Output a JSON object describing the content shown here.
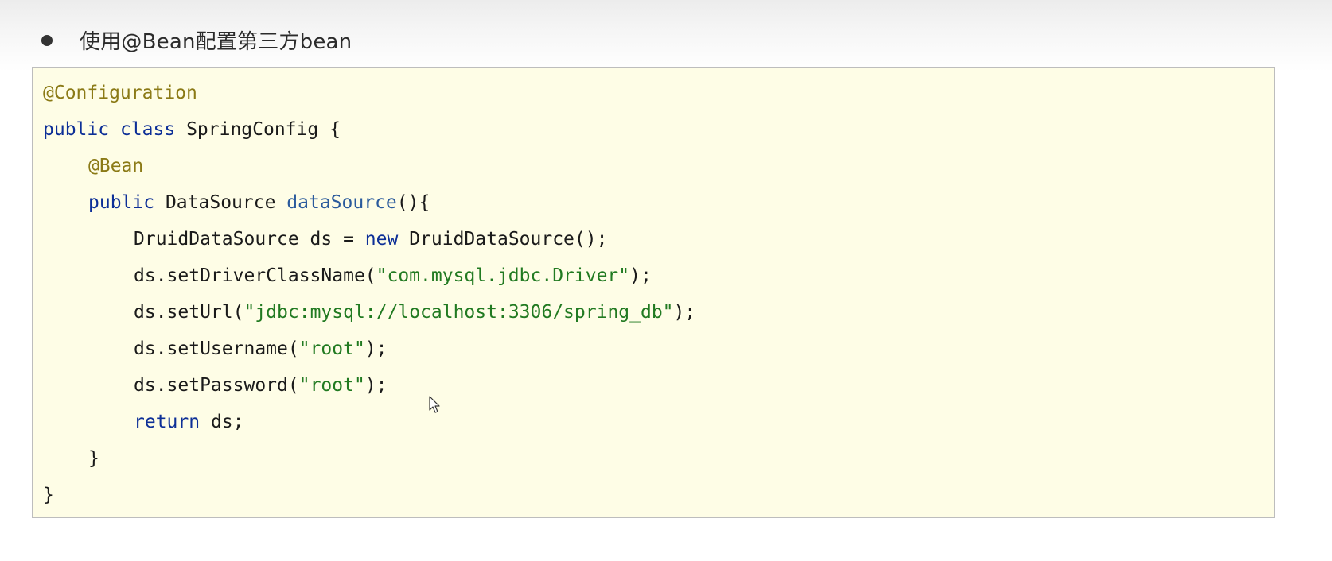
{
  "heading": {
    "bullet": "●",
    "text": "使用@Bean配置第三方bean"
  },
  "code": {
    "line1": {
      "annotation": "@Configuration"
    },
    "line2": {
      "kw1": "public",
      "kw2": "class",
      "rest": "SpringConfig {"
    },
    "line3": {
      "annotation": "@Bean"
    },
    "line4": {
      "kw": "public",
      "type": "DataSource",
      "method": "dataSource",
      "rest": "(){"
    },
    "line5": {
      "pre": "DruidDataSource ds = ",
      "kw": "new",
      "post": " DruidDataSource();"
    },
    "line6": {
      "pre": "ds.setDriverClassName(",
      "str": "\"com.mysql.jdbc.Driver\"",
      "post": ");"
    },
    "line7": {
      "pre": "ds.setUrl(",
      "str": "\"jdbc:mysql://localhost:3306/spring_db\"",
      "post": ");"
    },
    "line8": {
      "pre": "ds.setUsername(",
      "str": "\"root\"",
      "post": ");"
    },
    "line9": {
      "pre": "ds.setPassword(",
      "str": "\"root\"",
      "post": ");"
    },
    "line10": {
      "kw": "return",
      "rest": " ds;"
    },
    "line11": {
      "text": "}"
    },
    "line12": {
      "text": "}"
    }
  },
  "colors": {
    "annotation": "#8b7a16",
    "keyword": "#0d2f97",
    "method": "#2a5a9c",
    "string": "#217a21",
    "panel_background": "#fefde6"
  },
  "icons": {
    "cursor": "mouse-pointer-icon"
  }
}
